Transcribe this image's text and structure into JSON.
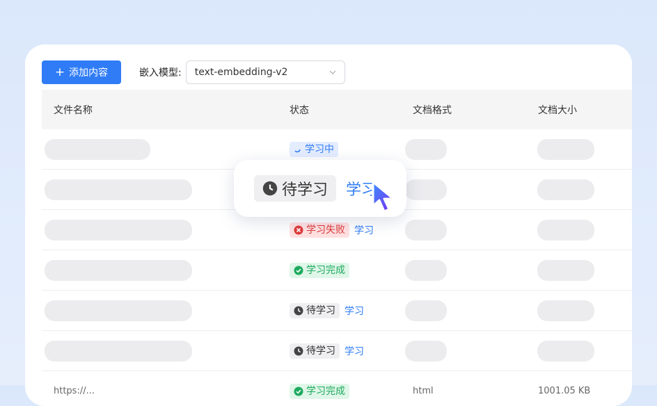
{
  "toolbar": {
    "add_label": "添加内容",
    "embedding_label": "嵌入模型:",
    "embedding_value": "text-embedding-v2"
  },
  "table": {
    "headers": [
      "文件名称",
      "状态",
      "文档格式",
      "文档大小"
    ],
    "status_labels": {
      "learning": "学习中",
      "failed": "学习失败",
      "done": "学习完成",
      "pending": "待学习"
    },
    "action_label": "学习",
    "last_row": {
      "name": "https://...",
      "status": "学习完成",
      "format": "html",
      "size": "1001.05 KB"
    }
  },
  "popup": {
    "status": "待学习",
    "action": "学习"
  },
  "colors": {
    "accent": "#2f7cf6",
    "fail": "#e03a3a",
    "success": "#1eaa5e"
  }
}
